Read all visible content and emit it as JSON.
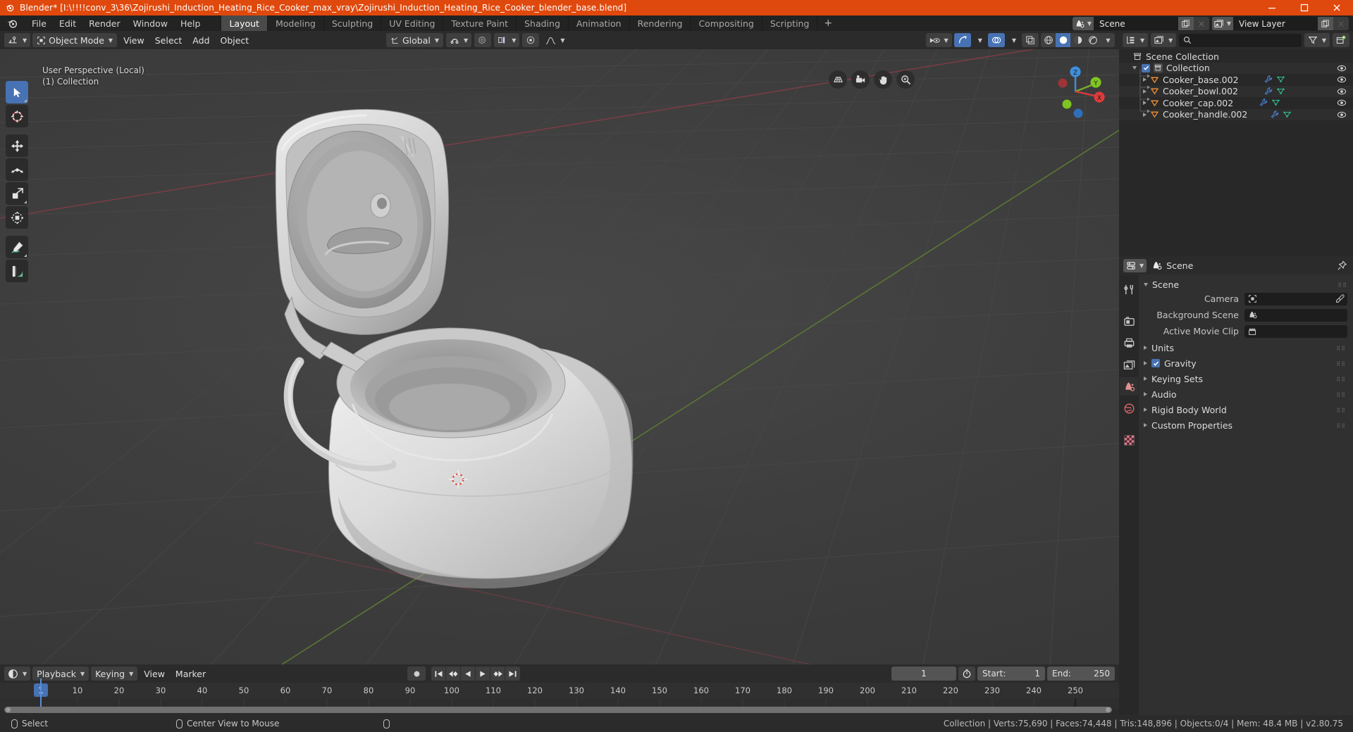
{
  "titlebar": {
    "text": "Blender* [I:\\!!!!conv_3\\36\\Zojirushi_Induction_Heating_Rice_Cooker_max_vray\\Zojirushi_Induction_Heating_Rice_Cooker_blender_base.blend]",
    "accent_color": "#e0490d",
    "minimize_label": "minimize-icon",
    "maximize_label": "maximize-icon",
    "close_label": "close-icon"
  },
  "topbar": {
    "menus": [
      "File",
      "Edit",
      "Render",
      "Window",
      "Help"
    ],
    "workspaces": [
      {
        "label": "Layout",
        "active": true
      },
      {
        "label": "Modeling",
        "active": false
      },
      {
        "label": "Sculpting",
        "active": false
      },
      {
        "label": "UV Editing",
        "active": false
      },
      {
        "label": "Texture Paint",
        "active": false
      },
      {
        "label": "Shading",
        "active": false
      },
      {
        "label": "Animation",
        "active": false
      },
      {
        "label": "Rendering",
        "active": false
      },
      {
        "label": "Compositing",
        "active": false
      },
      {
        "label": "Scripting",
        "active": false
      }
    ],
    "add_workspace_label": "+",
    "scene_name": "Scene",
    "view_layer_name": "View Layer"
  },
  "viewport": {
    "mode": "Object Mode",
    "menus": [
      "View",
      "Select",
      "Add",
      "Object"
    ],
    "transform_orientation": "Global",
    "overlay_line1": "User Perspective (Local)",
    "overlay_line2": "(1) Collection",
    "gizmo_axes": [
      "X",
      "Y",
      "Z"
    ],
    "tools": [
      "select-box-tool",
      "cursor-tool",
      "move-tool",
      "rotate-tool",
      "scale-tool",
      "transform-tool",
      "annotate-tool",
      "measure-tool"
    ],
    "nav_buttons": [
      "grid-toggle-icon",
      "camera-view-icon",
      "pan-view-icon",
      "zoom-view-icon"
    ]
  },
  "outliner": {
    "search_placeholder": "",
    "rows": [
      {
        "label": "Scene Collection",
        "indent": 0,
        "icon": "collection-icon",
        "expander": "",
        "checkbox": false,
        "modifiers": false,
        "eye": false
      },
      {
        "label": "Collection",
        "indent": 1,
        "icon": "collection-icon",
        "expander": "down",
        "checkbox": true,
        "modifiers": false,
        "eye": true
      },
      {
        "label": "Cooker_base.002",
        "indent": 2,
        "icon": "mesh-object-icon",
        "expander": "right",
        "checkbox": false,
        "modifiers": true,
        "eye": true
      },
      {
        "label": "Cooker_bowl.002",
        "indent": 2,
        "icon": "mesh-object-icon",
        "expander": "right",
        "checkbox": false,
        "modifiers": true,
        "eye": true
      },
      {
        "label": "Cooker_cap.002",
        "indent": 2,
        "icon": "mesh-object-icon",
        "expander": "right",
        "checkbox": false,
        "modifiers": true,
        "eye": true
      },
      {
        "label": "Cooker_handle.002",
        "indent": 2,
        "icon": "mesh-object-icon",
        "expander": "right",
        "checkbox": false,
        "modifiers": true,
        "eye": true
      }
    ]
  },
  "properties": {
    "breadcrumb": "Scene",
    "tabs": [
      "tool-tab",
      "render-tab",
      "output-tab",
      "view-layer-tab",
      "scene-tab",
      "world-tab",
      "texture-tab"
    ],
    "active_tab_index": 4,
    "panel_title": "Scene",
    "fields": [
      {
        "label": "Camera",
        "value": "",
        "icon": "camera-data-icon",
        "eyedropper": true
      },
      {
        "label": "Background Scene",
        "value": "",
        "icon": "scene-icon",
        "eyedropper": false
      },
      {
        "label": "Active Movie Clip",
        "value": "",
        "icon": "movie-clip-icon",
        "eyedropper": false
      }
    ],
    "sections": [
      {
        "label": "Units",
        "checkbox": false
      },
      {
        "label": "Gravity",
        "checkbox": true
      },
      {
        "label": "Keying Sets",
        "checkbox": false
      },
      {
        "label": "Audio",
        "checkbox": false
      },
      {
        "label": "Rigid Body World",
        "checkbox": false
      },
      {
        "label": "Custom Properties",
        "checkbox": false
      }
    ]
  },
  "timeline": {
    "menus": [
      "Playback",
      "Keying",
      "View",
      "Marker"
    ],
    "current_frame": "1",
    "start_label": "Start:",
    "start_value": "1",
    "end_label": "End:",
    "end_value": "250",
    "ruler_ticks": [
      "10",
      "20",
      "30",
      "40",
      "50",
      "60",
      "70",
      "80",
      "90",
      "100",
      "110",
      "120",
      "130",
      "140",
      "150",
      "160",
      "170",
      "180",
      "190",
      "200",
      "210",
      "220",
      "230",
      "240",
      "250"
    ],
    "playhead_frame": "1",
    "transport_buttons": [
      "jump-start-icon",
      "prev-keyframe-icon",
      "play-reverse-icon",
      "play-icon",
      "next-keyframe-icon",
      "jump-end-icon"
    ],
    "record_button": "record-icon"
  },
  "statusbar": {
    "left_items": [
      {
        "icon": "mouse-left-icon",
        "label": "Select"
      },
      {
        "icon": "mouse-middle-icon",
        "label": "Center View to Mouse"
      },
      {
        "icon": "mouse-right-icon",
        "label": ""
      }
    ],
    "stats": "Collection | Verts:75,690 | Faces:74,448 | Tris:148,896 | Objects:0/4 | Mem: 48.4 MB | v2.80.75"
  }
}
